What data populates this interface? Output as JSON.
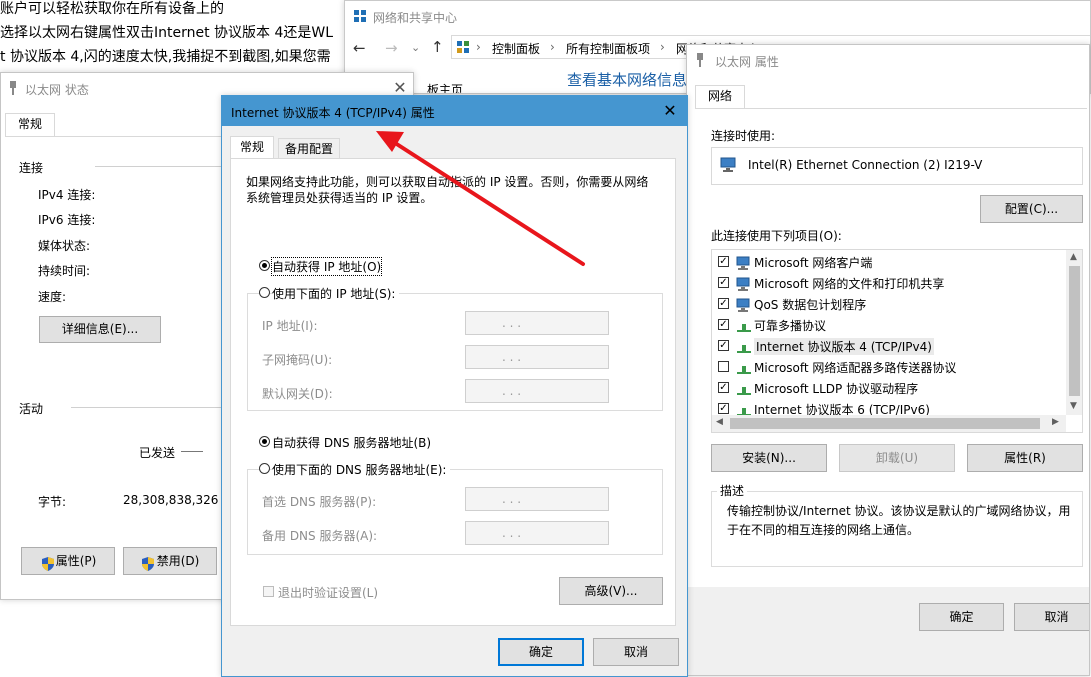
{
  "background": {
    "line1": "账户可以轻松获取你在所有设备上的",
    "line2": "选择以太网右键属性双击Internet 协议版本 4还是WL",
    "line3": "t 协议版本 4,闪的速度太快,我捕捉不到截图,如果您需"
  },
  "nsc": {
    "title": "网络和共享中心",
    "breadcrumb": [
      "控制面板",
      "所有控制面板项",
      "网络和共享中心"
    ],
    "heading": "查看基本网络信息",
    "home_link": "板主页"
  },
  "status": {
    "title": "以太网 状态",
    "tab": "常规",
    "connection_header": "连接",
    "fields": [
      "IPv4 连接:",
      "IPv6 连接:",
      "媒体状态:",
      "持续时间:",
      "速度:"
    ],
    "details_button": "详细信息(E)...",
    "activity_header": "活动",
    "sent_label": "已发送",
    "bytes_label": "字节:",
    "bytes_value": "28,308,838,326",
    "properties_button": "属性(P)",
    "disable_button": "禁用(D)"
  },
  "ipv4": {
    "title": "Internet 协议版本 4 (TCP/IPv4) 属性",
    "tabs": [
      "常规",
      "备用配置"
    ],
    "description": "如果网络支持此功能，则可以获取自动指派的 IP 设置。否则，你需要从网络系统管理员处获得适当的 IP 设置。",
    "auto_ip": "自动获得 IP 地址(O)",
    "manual_ip": "使用下面的 IP 地址(S):",
    "ip_fields": [
      "IP 地址(I):",
      "子网掩码(U):",
      "默认网关(D):"
    ],
    "auto_dns": "自动获得 DNS 服务器地址(B)",
    "manual_dns": "使用下面的 DNS 服务器地址(E):",
    "dns_fields": [
      "首选 DNS 服务器(P):",
      "备用 DNS 服务器(A):"
    ],
    "ip_placeholder": ".          .          .",
    "validate_on_exit": "退出时验证设置(L)",
    "advanced_button": "高级(V)...",
    "ok_button": "确定",
    "cancel_button": "取消"
  },
  "ethprops": {
    "title": "以太网 属性",
    "tab": "网络",
    "connect_using_label": "连接时使用:",
    "adapter": "Intel(R) Ethernet Connection (2) I219-V",
    "configure_button": "配置(C)...",
    "items_label": "此连接使用下列项目(O):",
    "items": [
      {
        "label": "Microsoft 网络客户端",
        "checked": true
      },
      {
        "label": "Microsoft 网络的文件和打印机共享",
        "checked": true
      },
      {
        "label": "QoS 数据包计划程序",
        "checked": true
      },
      {
        "label": "可靠多播协议",
        "checked": true
      },
      {
        "label": "Internet 协议版本 4 (TCP/IPv4)",
        "checked": true
      },
      {
        "label": "Microsoft 网络适配器多路传送器协议",
        "checked": false
      },
      {
        "label": "Microsoft LLDP 协议驱动程序",
        "checked": true
      },
      {
        "label": "Internet 协议版本 6 (TCP/IPv6)",
        "checked": true
      }
    ],
    "install_button": "安装(N)...",
    "uninstall_button": "卸载(U)",
    "properties_button": "属性(R)",
    "description_header": "描述",
    "description": "传输控制协议/Internet 协议。该协议是默认的广域网络协议，用于在不同的相互连接的网络上通信。",
    "ok_button": "确定",
    "cancel_button": "取消"
  },
  "colors": {
    "accent": "#0078d7",
    "title_active": "#4596d0",
    "link": "#1a5fa6",
    "arrow": "#e8161c"
  }
}
